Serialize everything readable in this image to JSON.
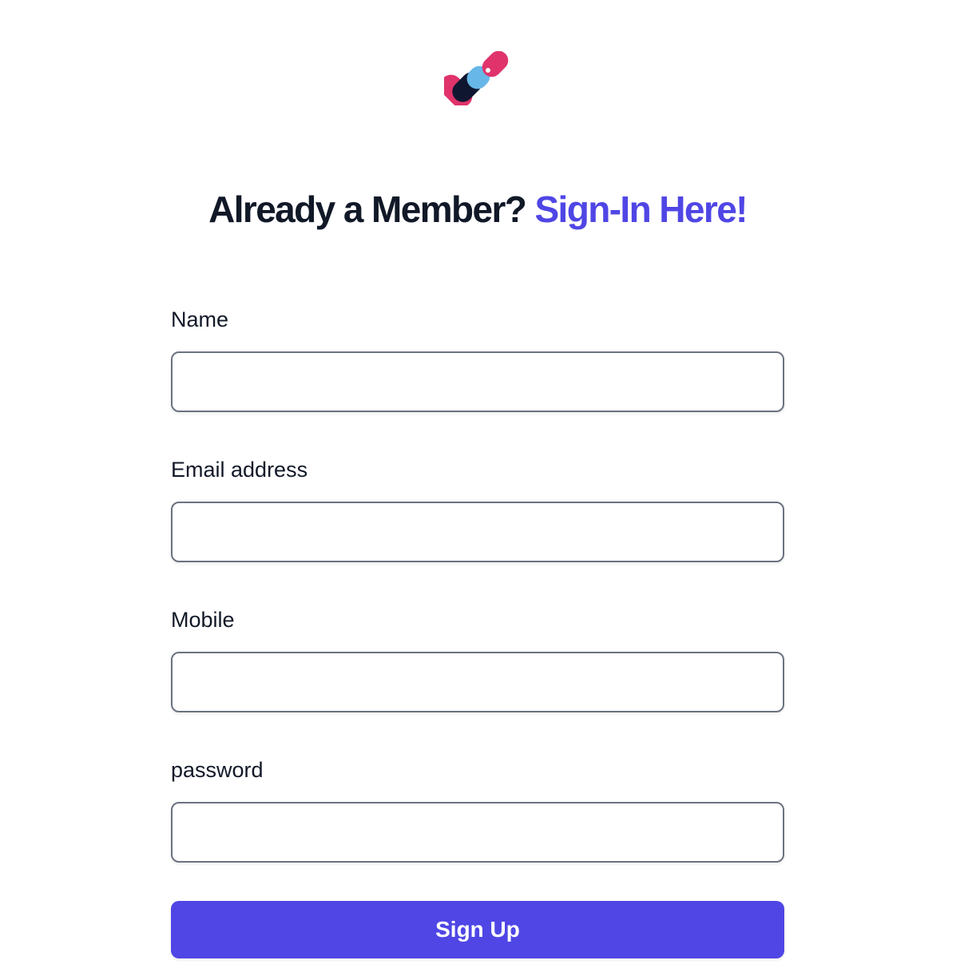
{
  "logo": {
    "icon": "heart-logo-icon",
    "colors": {
      "pink": "#e0336b",
      "blue": "#67b7e8",
      "navy": "#0f1730"
    }
  },
  "heading": {
    "prefix": "Already a Member? ",
    "link": "Sign-In Here!",
    "link_color": "#4f46e5"
  },
  "form": {
    "name_label": "Name",
    "name_value": "",
    "email_label": "Email address",
    "email_value": "",
    "mobile_label": "Mobile",
    "mobile_value": "",
    "password_label": "password",
    "password_value": "",
    "submit_label": "Sign Up",
    "accent_color": "#4f46e5"
  }
}
